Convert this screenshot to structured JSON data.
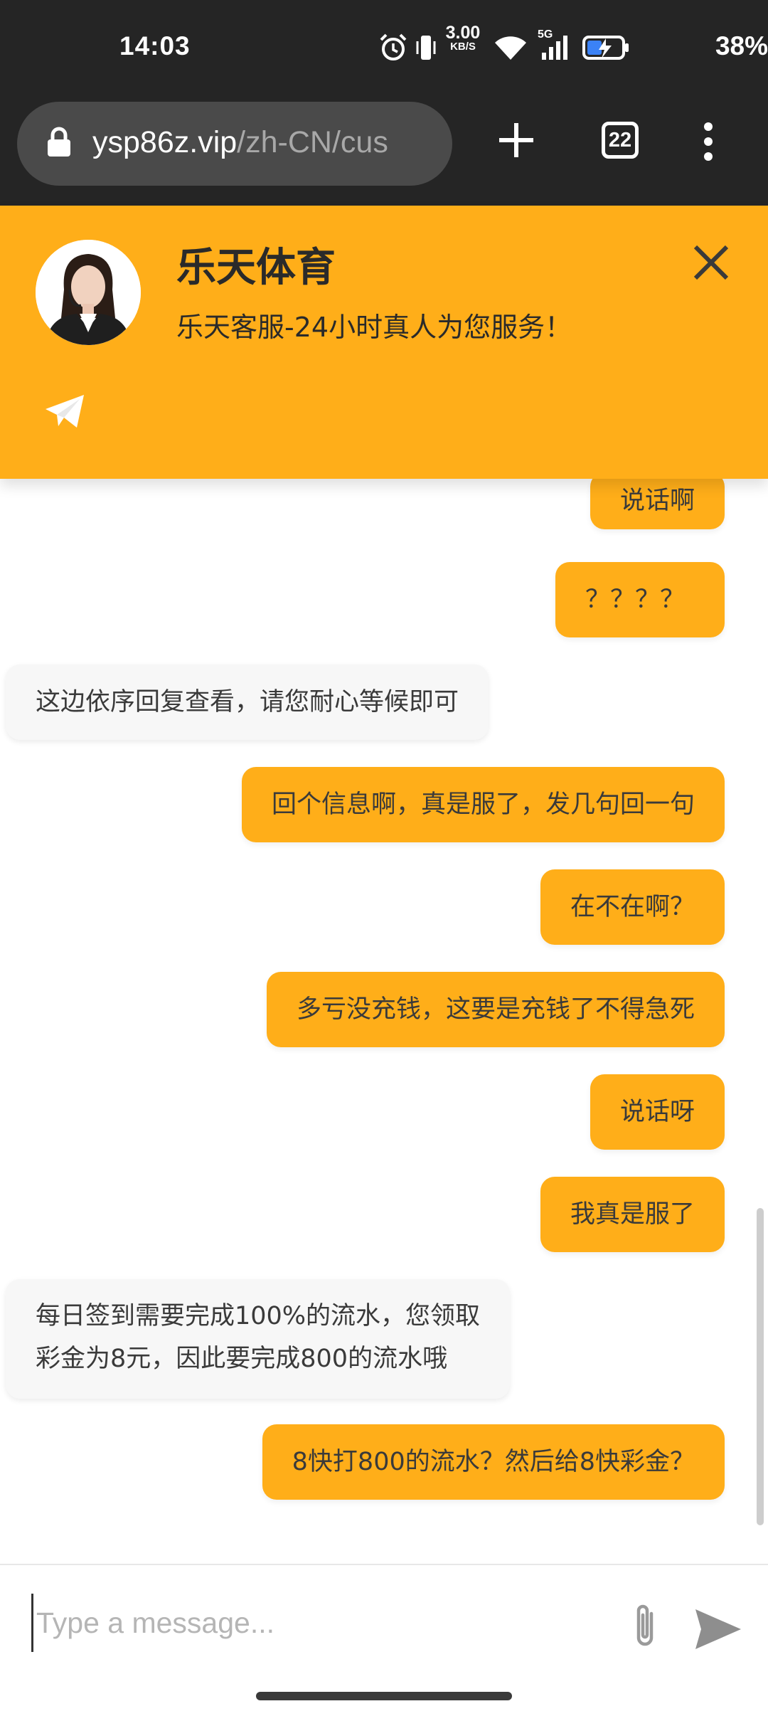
{
  "status_bar": {
    "time": "14:03",
    "net_speed": "3.00",
    "net_unit": "KB/S",
    "network": "5G",
    "battery": "38%"
  },
  "browser": {
    "url_host": "ysp86z.vip",
    "url_path": "/zh-CN/cus",
    "tab_count": "22"
  },
  "chat_header": {
    "name": "乐天体育",
    "subtitle": "乐天客服-24小时真人为您服务！",
    "accent_color": "#ffae19"
  },
  "messages": [
    {
      "side": "out",
      "text": "说话啊"
    },
    {
      "side": "out",
      "text": "？？？？"
    },
    {
      "side": "in",
      "text": "这边依序回复查看，请您耐心等候即可"
    },
    {
      "side": "out",
      "text": "回个信息啊，真是服了，发几句回一句"
    },
    {
      "side": "out",
      "text": "在不在啊？"
    },
    {
      "side": "out",
      "text": "多亏没充钱，这要是充钱了不得急死"
    },
    {
      "side": "out",
      "text": "说话呀"
    },
    {
      "side": "out",
      "text": "我真是服了"
    },
    {
      "side": "in",
      "line1": "每日签到需要完成100%的流水，您领取",
      "line2": "彩金为8元，因此要完成800的流水哦"
    },
    {
      "side": "out",
      "text": "8快打800的流水？然后给8快彩金？"
    }
  ],
  "composer": {
    "placeholder": "Type a message..."
  }
}
